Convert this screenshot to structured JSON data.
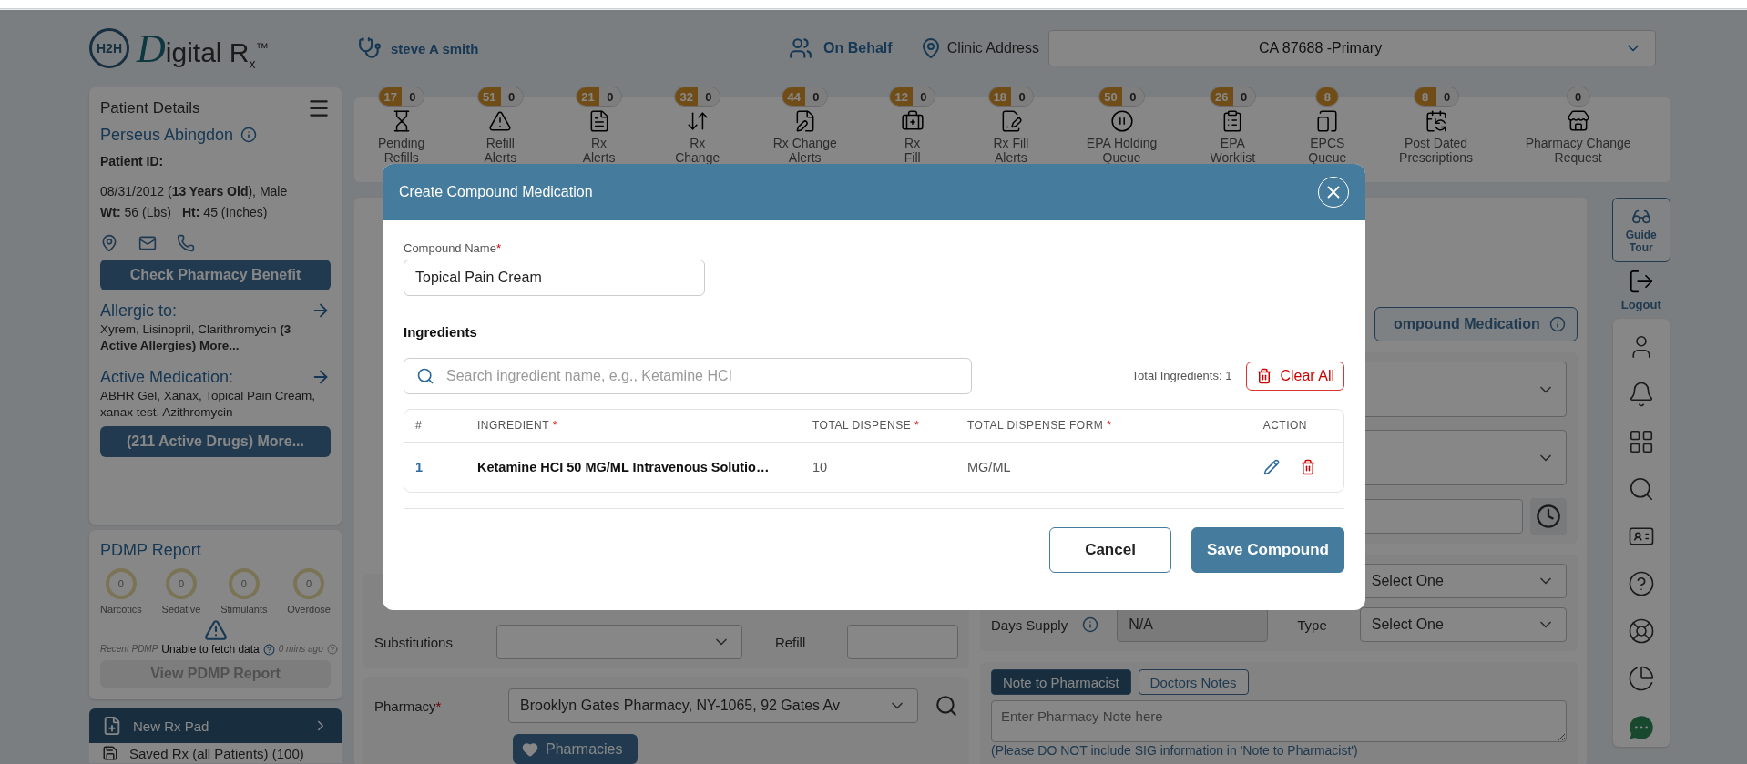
{
  "header": {
    "logo": {
      "badge": "H2H",
      "initial": "D",
      "text": "igital R$_{x}$$^{™}$"
    },
    "user": "steve A smith",
    "on_behalf": "On Behalf",
    "clinic_label": "Clinic Address",
    "clinic_address": "CA 87688 -Primary"
  },
  "queues": [
    {
      "label": "Pending\nRefills",
      "badges": [
        {
          "text": "17",
          "kind": "alert"
        },
        {
          "text": "0",
          "kind": "plain"
        }
      ]
    },
    {
      "label": "Refill\nAlerts",
      "badges": [
        {
          "text": "51",
          "kind": "alert"
        },
        {
          "text": "0",
          "kind": "plain"
        }
      ]
    },
    {
      "label": "Rx\nAlerts",
      "badges": [
        {
          "text": "21",
          "kind": "alert"
        },
        {
          "text": "0",
          "kind": "plain"
        }
      ]
    },
    {
      "label": "Rx\nChange",
      "badges": [
        {
          "text": "32",
          "kind": "alert"
        },
        {
          "text": "0",
          "kind": "plain"
        }
      ]
    },
    {
      "label": "Rx Change\nAlerts",
      "badges": [
        {
          "text": "44",
          "kind": "alert"
        },
        {
          "text": "0",
          "kind": "plain"
        }
      ]
    },
    {
      "label": "Rx\nFill",
      "badges": [
        {
          "text": "12",
          "kind": "alert"
        },
        {
          "text": "0",
          "kind": "plain"
        }
      ]
    },
    {
      "label": "Rx Fill\nAlerts",
      "badges": [
        {
          "text": "18",
          "kind": "alert"
        },
        {
          "text": "0",
          "kind": "plain"
        }
      ]
    },
    {
      "label": "EPA Holding\nQueue",
      "badges": [
        {
          "text": "50",
          "kind": "alert"
        },
        {
          "text": "0",
          "kind": "plain"
        }
      ]
    },
    {
      "label": "EPA\nWorklist",
      "badges": [
        {
          "text": "26",
          "kind": "alert"
        },
        {
          "text": "0",
          "kind": "plain"
        }
      ]
    },
    {
      "label": "EPCS\nQueue",
      "badges": [
        {
          "text": "8",
          "kind": "alert"
        }
      ]
    },
    {
      "label": "Post Dated\nPrescriptions",
      "badges": [
        {
          "text": "8",
          "kind": "alert"
        },
        {
          "text": "0",
          "kind": "plain"
        }
      ]
    },
    {
      "label": "Pharmacy Change\nRequest",
      "badges": [
        {
          "text": "0",
          "kind": "plain"
        }
      ]
    }
  ],
  "patient": {
    "title": "Patient Details",
    "name": "Perseus Abingdon",
    "id_label": "Patient ID:",
    "birth": "08/31/2012 (**13 Years Old**), Male",
    "weight_label": "Wt:",
    "weight": "56 (Lbs)",
    "height_label": "Ht:",
    "height": "45 (Inches)",
    "benefit_button": "Check Pharmacy Benefit",
    "allergy_title": "Allergic to:",
    "allergies": "Xyrem, Lisinopril, Clarithromycin **(3 Active Allergies) More...**",
    "medication_title": "Active Medication:",
    "medications": "ABHR Gel, Xanax, Topical Pain Cream, xanax test, Azithromycin",
    "drugs_button": "(211 Active Drugs) More..."
  },
  "pdmp": {
    "title": "PDMP Report",
    "meters": [
      {
        "value": "0",
        "label": "Narcotics"
      },
      {
        "value": "0",
        "label": "Sedative"
      },
      {
        "value": "0",
        "label": "Stimulants"
      },
      {
        "value": "0",
        "label": "Overdose"
      }
    ],
    "note_start": "Recent PDMP",
    "note_end": "0 mins ago",
    "message": "Unable to fetch data",
    "button": "View PDMP Report"
  },
  "nav": [
    {
      "label": "New Rx Pad",
      "selected": true
    },
    {
      "label": "Saved Rx (all Patients) (100)",
      "selected": false
    }
  ],
  "form": {
    "substitutions_label": "Substitutions",
    "refill_label": "Refill",
    "pharmacy_label": "Pharmacy",
    "pharmacy_marker": "*",
    "pharmacy": "Brooklyn Gates Pharmacy, NY-1065, 92 Gates Av",
    "pharmacies_button": "Pharmacies",
    "compound_button": "ompound Medication",
    "frequency_select": "Select One",
    "days_supply_label": "Days Supply",
    "days_supply": "N/A",
    "type_label": "Type",
    "type_select": "Select One",
    "note_tabs": [
      {
        "label": "Note to Pharmacist",
        "selected": true
      },
      {
        "label": "Doctors Notes",
        "selected": false
      }
    ],
    "note_placeholder": "Enter Pharmacy Note here",
    "note_hint": "(Please DO NOT include SIG information in 'Note to Pharmacist')"
  },
  "rail": {
    "guide": "Guide Tour",
    "logout": "Logout"
  },
  "modal": {
    "title": "Create Compound Medication",
    "name_label": "Compound Name",
    "name_marker": "*",
    "name_value": "Topical Pain Cream",
    "section": "Ingredients",
    "search_placeholder": "Search ingredient name, e.g., Ketamine HCI",
    "total": "Total Ingredients: 1",
    "clear_button": "Clear All",
    "columns": [
      {
        "label": "#"
      },
      {
        "label": "INGREDIENT",
        "marker": "*"
      },
      {
        "label": "TOTAL DISPENSE",
        "marker": "*"
      },
      {
        "label": "TOTAL DISPENSE FORM",
        "marker": "*"
      },
      {
        "label": "ACTION"
      }
    ],
    "rows": [
      {
        "index": "1",
        "ingredient": "Ketamine HCI 50 MG/ML Intravenous Solutio…",
        "dispense": "10",
        "form": "MG/ML"
      }
    ],
    "cancel_button": "Cancel",
    "save_button": "Save Compound"
  }
}
